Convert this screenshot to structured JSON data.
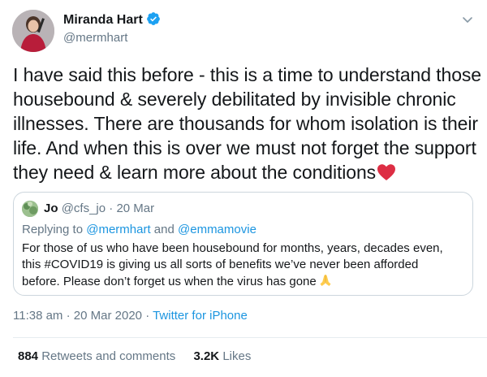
{
  "author": {
    "display_name": "Miranda Hart",
    "handle": "@mermhart",
    "verified": true
  },
  "tweet": {
    "lines": [
      "I have said this before - this is a time to understand those",
      "housebound & severely debilitated by invisible chronic",
      "illnesses. There are thousands for whom isolation is their",
      "life. And when this is over we must not forget the support",
      "they need & learn more about the conditions"
    ],
    "emoji_icon": "red-heart-icon"
  },
  "quoted_tweet": {
    "name": "Jo",
    "handle": "@cfs_jo",
    "separator": "·",
    "date": "20 Mar",
    "reply_prefix": "Replying to",
    "reply_mention_1": "@mermhart",
    "reply_and": "and",
    "reply_mention_2": "@emmamovie",
    "lines": [
      "For those of us who have been housebound for months, years, decades even,",
      "this #COVID19 is giving us all sorts of benefits we’ve never been afforded",
      "before. Please don’t forget us when the virus has gone"
    ],
    "emoji_icon": "folded-hands-icon"
  },
  "meta": {
    "time": "11:38 am",
    "separator": "·",
    "date": "20 Mar 2020",
    "source": "Twitter for iPhone"
  },
  "stats": {
    "retweets_count": "884",
    "retweets_label": "Retweets and comments",
    "likes_count": "3.2K",
    "likes_label": "Likes"
  },
  "colors": {
    "link": "#1b95e0",
    "secondary_text": "#657786",
    "heart": "#e0245e"
  }
}
